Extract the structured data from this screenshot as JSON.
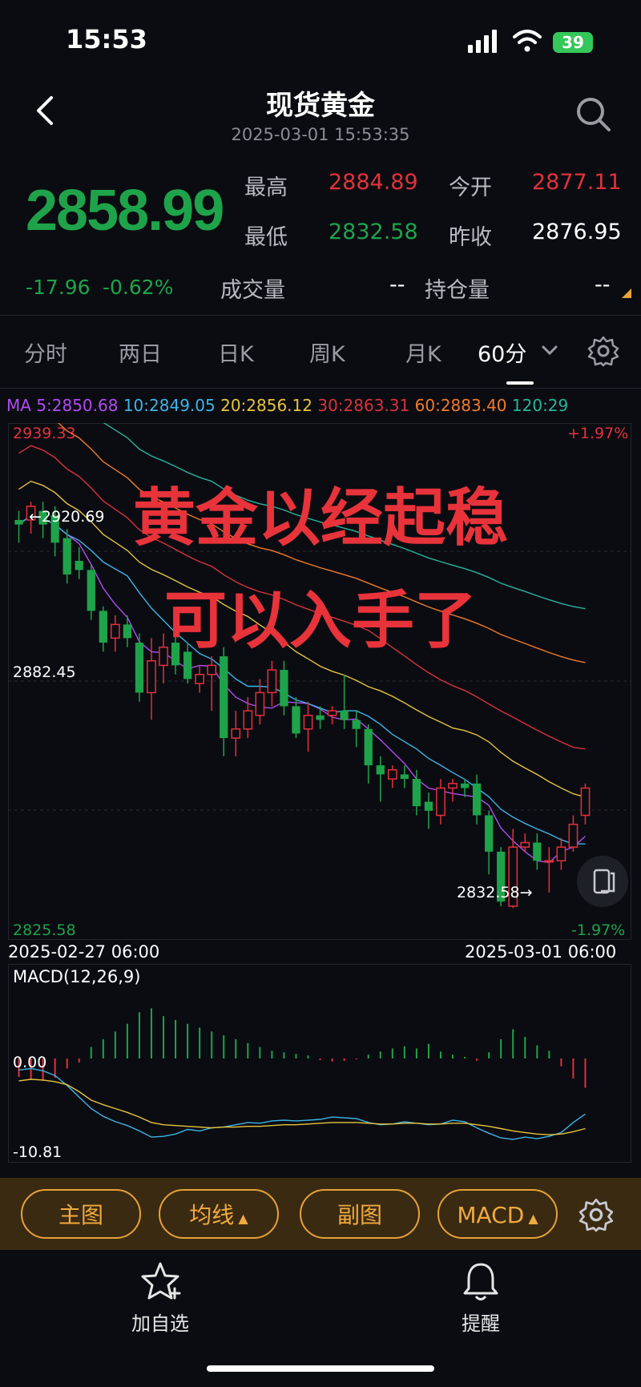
{
  "status_bar": {
    "time": "15:53",
    "battery": "39"
  },
  "header": {
    "title": "现货黄金",
    "subtitle": "2025-03-01 15:53:35"
  },
  "quote": {
    "price": "2858.99",
    "change": "-17.96",
    "change_pct": "-0.62%",
    "high_label": "最高",
    "high": "2884.89",
    "low_label": "最低",
    "low": "2832.58",
    "open_label": "今开",
    "open": "2877.11",
    "prev_close_label": "昨收",
    "prev_close": "2876.95",
    "volume_label": "成交量",
    "volume": "--",
    "open_interest_label": "持仓量",
    "open_interest": "--"
  },
  "tabs": [
    {
      "label": "分时"
    },
    {
      "label": "两日"
    },
    {
      "label": "日K"
    },
    {
      "label": "周K"
    },
    {
      "label": "月K"
    },
    {
      "label": "60分"
    }
  ],
  "ma_legend": {
    "prefix": "MA",
    "items": [
      {
        "label": "5:2850.68",
        "color": "#b04cf0"
      },
      {
        "label": "10:2849.05",
        "color": "#3db4e6"
      },
      {
        "label": "20:2856.12",
        "color": "#e6c43c"
      },
      {
        "label": "30:2863.31",
        "color": "#d8323a"
      },
      {
        "label": "60:2883.40",
        "color": "#f07a28"
      },
      {
        "label": "120:29",
        "color": "#27b59a"
      }
    ]
  },
  "chart_labels": {
    "top_price": "2939.33",
    "top_pct": "+1.97%",
    "mid_price": "2882.45",
    "bottom_price": "2825.58",
    "bottom_pct": "-1.97%",
    "high_marker": "←2920.69",
    "low_marker": "2832.58→",
    "start_date": "2025-02-27 06:00",
    "end_date": "2025-03-01 06:00"
  },
  "overlay": {
    "line1": "黄金以经起稳",
    "line2": "可以入手了"
  },
  "macd": {
    "title": "MACD(12,26,9)",
    "zero": "0.00",
    "min": "-10.81"
  },
  "toolbar": {
    "main_chart": "主图",
    "ma": "均线",
    "sub_chart": "副图",
    "indicator": "MACD"
  },
  "bottom_nav": {
    "add_watch": "加自选",
    "alert": "提醒"
  },
  "colors": {
    "up": "#e2313b",
    "down": "#1fa34a",
    "accent": "#f0aa3f"
  },
  "chart_data": {
    "type": "candlestick",
    "x_range": [
      "2025-02-27 06:00",
      "2025-03-01 06:00"
    ],
    "ylim": [
      2825.58,
      2939.33
    ],
    "candles": [
      {
        "o": 2918,
        "h": 2920,
        "c": 2917,
        "l": 2913
      },
      {
        "o": 2918,
        "h": 2922,
        "c": 2921,
        "l": 2915
      },
      {
        "o": 2920,
        "h": 2922,
        "c": 2917,
        "l": 2914
      },
      {
        "o": 2919,
        "h": 2921,
        "c": 2913,
        "l": 2910
      },
      {
        "o": 2914,
        "h": 2916,
        "c": 2906,
        "l": 2904
      },
      {
        "o": 2909,
        "h": 2912,
        "c": 2907,
        "l": 2905
      },
      {
        "o": 2907,
        "h": 2908,
        "c": 2898,
        "l": 2896
      },
      {
        "o": 2898,
        "h": 2899,
        "c": 2891,
        "l": 2889
      },
      {
        "o": 2892,
        "h": 2897,
        "c": 2895,
        "l": 2889
      },
      {
        "o": 2895,
        "h": 2897,
        "c": 2892,
        "l": 2890
      },
      {
        "o": 2891,
        "h": 2893,
        "c": 2880,
        "l": 2878
      },
      {
        "o": 2880,
        "h": 2892,
        "c": 2887,
        "l": 2874
      },
      {
        "o": 2886,
        "h": 2893,
        "c": 2890,
        "l": 2882
      },
      {
        "o": 2891,
        "h": 2893,
        "c": 2886,
        "l": 2884
      },
      {
        "o": 2889,
        "h": 2891,
        "c": 2883,
        "l": 2882
      },
      {
        "o": 2882,
        "h": 2886,
        "c": 2884,
        "l": 2880
      },
      {
        "o": 2884,
        "h": 2888,
        "c": 2886,
        "l": 2876
      },
      {
        "o": 2888,
        "h": 2890,
        "c": 2870,
        "l": 2866
      },
      {
        "o": 2870,
        "h": 2876,
        "c": 2872,
        "l": 2866
      },
      {
        "o": 2872,
        "h": 2879,
        "c": 2876,
        "l": 2870
      },
      {
        "o": 2875,
        "h": 2883,
        "c": 2880,
        "l": 2873
      },
      {
        "o": 2880,
        "h": 2887,
        "c": 2885,
        "l": 2877
      },
      {
        "o": 2885,
        "h": 2887,
        "c": 2877,
        "l": 2875
      },
      {
        "o": 2877,
        "h": 2879,
        "c": 2871,
        "l": 2870
      },
      {
        "o": 2872,
        "h": 2878,
        "c": 2875,
        "l": 2867
      },
      {
        "o": 2875,
        "h": 2877,
        "c": 2874,
        "l": 2872
      },
      {
        "o": 2875,
        "h": 2877,
        "c": 2876,
        "l": 2873
      },
      {
        "o": 2876,
        "h": 2884,
        "c": 2874,
        "l": 2872
      },
      {
        "o": 2874,
        "h": 2876,
        "c": 2872,
        "l": 2868
      },
      {
        "o": 2872,
        "h": 2873,
        "c": 2864,
        "l": 2860
      },
      {
        "o": 2864,
        "h": 2866,
        "c": 2862,
        "l": 2856
      },
      {
        "o": 2861,
        "h": 2864,
        "c": 2863,
        "l": 2859
      },
      {
        "o": 2862,
        "h": 2864,
        "c": 2861,
        "l": 2859
      },
      {
        "o": 2861,
        "h": 2863,
        "c": 2855,
        "l": 2853
      },
      {
        "o": 2856,
        "h": 2858,
        "c": 2854,
        "l": 2850
      },
      {
        "o": 2853,
        "h": 2861,
        "c": 2859,
        "l": 2851
      },
      {
        "o": 2859,
        "h": 2861,
        "c": 2860,
        "l": 2856
      },
      {
        "o": 2860,
        "h": 2861,
        "c": 2859,
        "l": 2857
      },
      {
        "o": 2860,
        "h": 2862,
        "c": 2853,
        "l": 2851
      },
      {
        "o": 2853,
        "h": 2854,
        "c": 2845,
        "l": 2840
      },
      {
        "o": 2845,
        "h": 2846,
        "c": 2834,
        "l": 2833
      },
      {
        "o": 2833,
        "h": 2850,
        "c": 2846,
        "l": 2832.58
      },
      {
        "o": 2846,
        "h": 2849,
        "c": 2847,
        "l": 2845
      },
      {
        "o": 2847,
        "h": 2849,
        "c": 2843,
        "l": 2841
      },
      {
        "o": 2843,
        "h": 2846,
        "c": 2843,
        "l": 2836
      },
      {
        "o": 2843,
        "h": 2848,
        "c": 2846,
        "l": 2841
      },
      {
        "o": 2846,
        "h": 2853,
        "c": 2851,
        "l": 2845
      },
      {
        "o": 2853,
        "h": 2860,
        "c": 2858.99,
        "l": 2851
      }
    ],
    "macd_hist": [
      2.4,
      2.7,
      2.9,
      2.5,
      1.3,
      0.5,
      -1.5,
      -2.5,
      -3.5,
      -4.5,
      -6.0,
      -6.5,
      -5.5,
      -5.0,
      -4.5,
      -4.0,
      -3.5,
      -3.0,
      -2.5,
      -2.0,
      -1.5,
      -1.0,
      -0.8,
      -0.6,
      -0.4,
      0.2,
      0.4,
      0.3,
      0.1,
      -0.5,
      -0.9,
      -1.3,
      -1.6,
      -1.3,
      -1.9,
      -0.9,
      -0.5,
      -0.2,
      0.3,
      -0.8,
      -2.5,
      -3.8,
      -2.8,
      -1.7,
      -1.0,
      1.0,
      2.6,
      3.8
    ],
    "macd_dif": [
      -1.5,
      -1.3,
      -1.6,
      -2.2,
      -3.5,
      -5.0,
      -6.5,
      -7.5,
      -8.2,
      -8.7,
      -9.4,
      -10.2,
      -10.1,
      -9.8,
      -9.2,
      -9.4,
      -9.0,
      -8.9,
      -8.6,
      -8.3,
      -8.4,
      -8.1,
      -8.0,
      -8.1,
      -8.0,
      -7.9,
      -7.6,
      -7.7,
      -7.8,
      -8.3,
      -8.6,
      -8.5,
      -8.2,
      -8.4,
      -8.6,
      -8.5,
      -8.0,
      -8.2,
      -9.0,
      -9.7,
      -10.3,
      -10.5,
      -10.2,
      -10.4,
      -10.1,
      -9.6,
      -8.3,
      -7.2
    ],
    "macd_dea": [
      -2.9,
      -2.7,
      -2.8,
      -3.0,
      -3.4,
      -4.3,
      -5.4,
      -6.0,
      -6.5,
      -7.0,
      -7.6,
      -8.3,
      -8.6,
      -8.7,
      -8.8,
      -8.9,
      -9.0,
      -8.9,
      -8.9,
      -8.8,
      -8.8,
      -8.7,
      -8.6,
      -8.6,
      -8.5,
      -8.4,
      -8.3,
      -8.3,
      -8.3,
      -8.4,
      -8.5,
      -8.5,
      -8.4,
      -8.4,
      -8.5,
      -8.5,
      -8.4,
      -8.4,
      -8.6,
      -8.8,
      -9.1,
      -9.4,
      -9.6,
      -9.8,
      -9.9,
      -9.8,
      -9.5,
      -9.1
    ]
  }
}
